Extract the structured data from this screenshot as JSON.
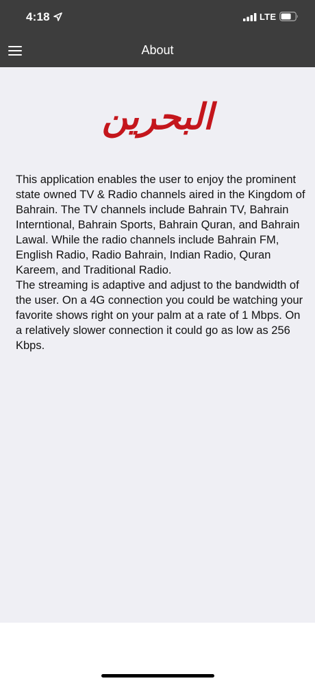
{
  "status_bar": {
    "time": "4:18",
    "network": "LTE"
  },
  "nav": {
    "title": "About",
    "menu_icon": "hamburger-menu-icon"
  },
  "logo": {
    "text": "البحرين",
    "color": "#c4161c"
  },
  "about": {
    "paragraph_1": "This application enables the user to enjoy the prominent state owned TV & Radio channels aired in the Kingdom of Bahrain. The TV channels include Bahrain TV, Bahrain Interntional, Bahrain Sports, Bahrain Quran, and Bahrain Lawal. While the radio channels include Bahrain FM, English Radio, Radio Bahrain, Indian Radio, Quran Kareem, and Traditional Radio.",
    "paragraph_2": "The streaming is adaptive and adjust to the bandwidth of the user. On a 4G connection you could be watching your favorite shows right on your palm at a rate of 1 Mbps. On a relatively slower connection it could go as low as 256 Kbps."
  },
  "colors": {
    "bar_background": "#3d3d3d",
    "content_background": "#efeff4",
    "logo_red": "#c4161c"
  }
}
